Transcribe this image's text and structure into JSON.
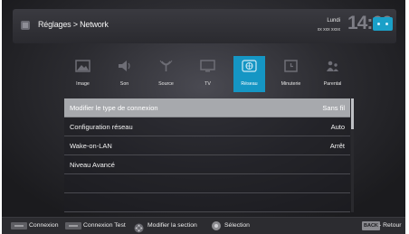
{
  "header": {
    "title": "Réglages > Network",
    "day": "Lundi",
    "date": "xx xxx xxxx",
    "clock": "14:00"
  },
  "tabs": [
    {
      "label": "Image",
      "icon": "picture-icon",
      "active": false
    },
    {
      "label": "Son",
      "icon": "speaker-icon",
      "active": false
    },
    {
      "label": "Source",
      "icon": "antenna-icon",
      "active": false
    },
    {
      "label": "TV",
      "icon": "tv-icon",
      "active": false
    },
    {
      "label": "Réseau",
      "icon": "globe-icon",
      "active": true
    },
    {
      "label": "Minuterie",
      "icon": "timer-icon",
      "active": false
    },
    {
      "label": "Parental",
      "icon": "parental-icon",
      "active": false
    }
  ],
  "settings": [
    {
      "label": "Modifier le type de connexion",
      "value": "Sans fil",
      "selected": true
    },
    {
      "label": "Configuration réseau",
      "value": "Auto",
      "selected": false
    },
    {
      "label": "Wake-on-LAN",
      "value": "Arrêt",
      "selected": false
    },
    {
      "label": "Niveau Avancé",
      "value": "",
      "selected": false
    },
    {
      "label": "",
      "value": "",
      "selected": false
    },
    {
      "label": "",
      "value": "",
      "selected": false
    }
  ],
  "footer": {
    "connexion": "Connexion",
    "connexion_test": "Connexion Test",
    "modify_section": "Modifier la section",
    "selection": "Sélection",
    "back_key": "BACK",
    "back_label": "- Retour"
  },
  "colors": {
    "accent": "#1596c4",
    "selected_row": "#a7a9ad",
    "background": "#1c1c1f"
  }
}
